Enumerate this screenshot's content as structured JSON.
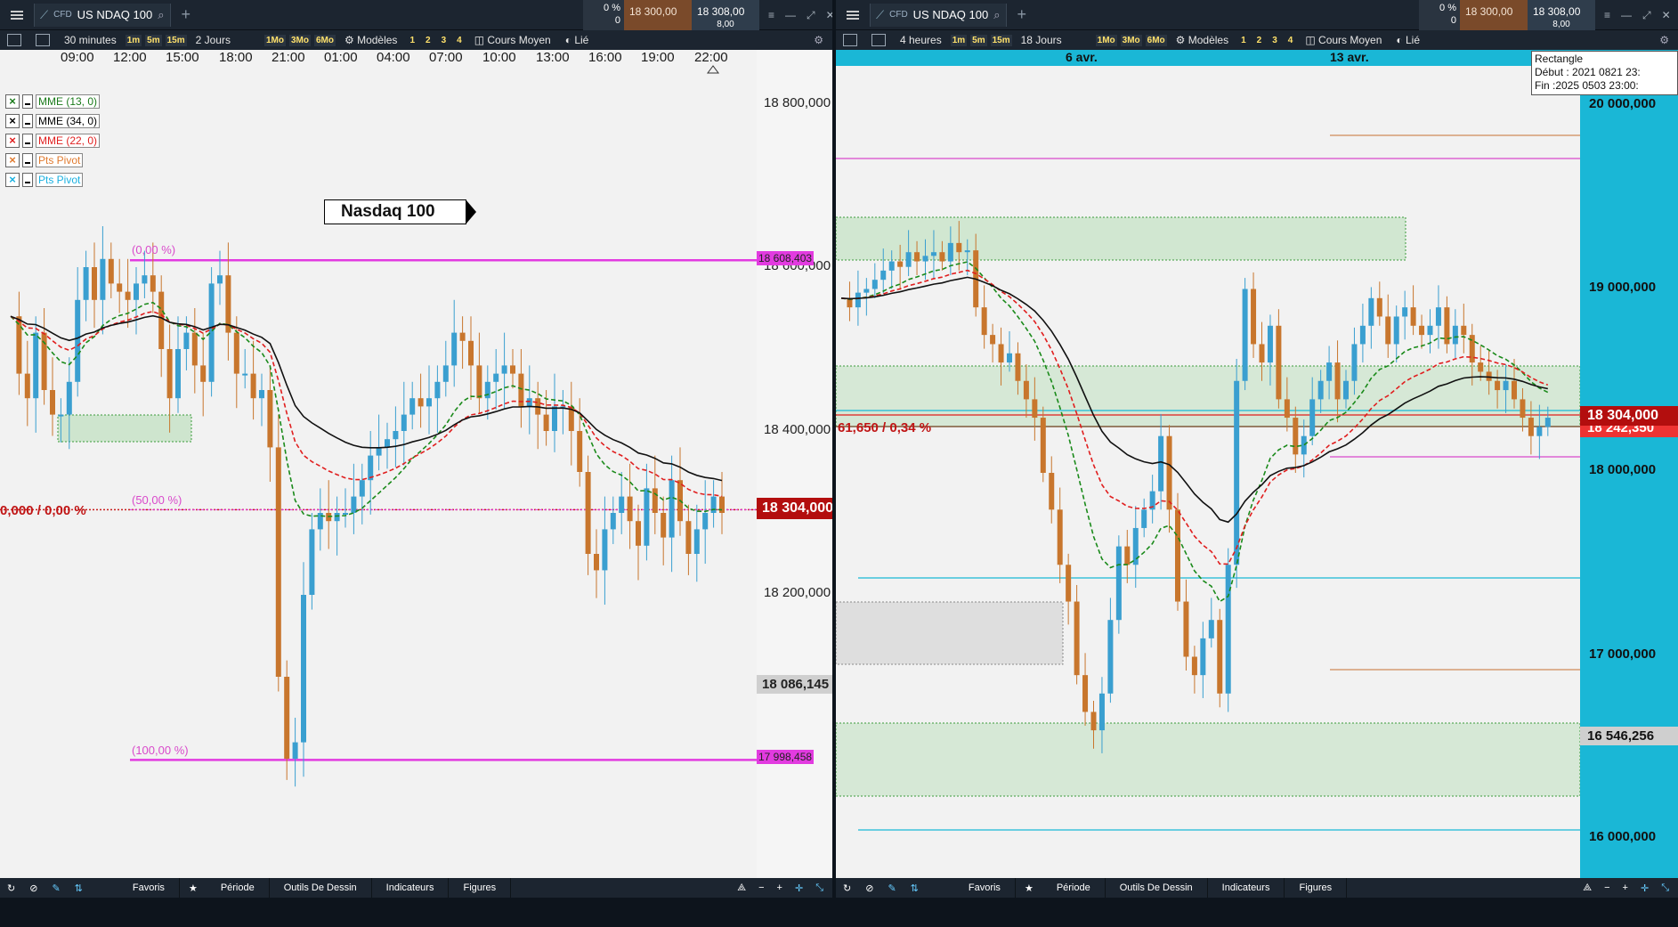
{
  "left": {
    "instrument": {
      "badge": "CFD",
      "name": "US NDAQ 100"
    },
    "quote": {
      "pct": "0 %",
      "pct_sub": "0",
      "bid": "18 300,00",
      "ask": "18 308,00",
      "spread": "8,00"
    },
    "toolbar": {
      "period": "30 minutes",
      "tf": [
        "1m",
        "5m",
        "15m"
      ],
      "range": "2 Jours",
      "tf2": [
        "1Mo",
        "3Mo",
        "6Mo"
      ],
      "models": "Modèles",
      "nums": [
        "1",
        "2",
        "3",
        "4"
      ],
      "price_type": "Cours Moyen",
      "linked": "Lié"
    },
    "time_axis": [
      "09:00",
      "12:00",
      "15:00",
      "18:00",
      "21:00",
      "01:00",
      "04:00",
      "07:00",
      "10:00",
      "13:00",
      "16:00",
      "19:00",
      "22:00"
    ],
    "indicators": [
      {
        "mark": "×",
        "label": "MME (13, 0)",
        "color": "#1a7a1a"
      },
      {
        "mark": "×",
        "label": "MME (34, 0)",
        "color": "#000000"
      },
      {
        "mark": "×",
        "label": "MME (22, 0)",
        "color": "#e01e1e"
      },
      {
        "mark": "×",
        "label": "Pts Pivot",
        "color": "#e07a2e"
      },
      {
        "mark": "×",
        "label": "Pts Pivot",
        "color": "#1ab0e0"
      }
    ],
    "chart_label": "Nasdaq 100",
    "fib": {
      "f0": "(0,00 %)",
      "f50": "(50,00 %)",
      "f100": "(100,00 %)"
    },
    "y_axis": [
      "18 800,000",
      "18 600,000",
      "18 400,000",
      "18 200,000"
    ],
    "tags": {
      "top": "18 608,403",
      "price": "18 304,000",
      "low_label": "18 086,145",
      "bottom": "17 998,458"
    },
    "left_text": "0,000 / 0,00 %",
    "bottom": [
      "Favoris",
      "Période",
      "Outils De Dessin",
      "Indicateurs",
      "Figures"
    ]
  },
  "right": {
    "instrument": {
      "badge": "CFD",
      "name": "US NDAQ 100"
    },
    "quote": {
      "pct": "0 %",
      "pct_sub": "0",
      "bid": "18 300,00",
      "ask": "18 308,00",
      "spread": "8,00"
    },
    "toolbar": {
      "period": "4 heures",
      "tf": [
        "1m",
        "5m",
        "15m"
      ],
      "range": "18 Jours",
      "tf2": [
        "1Mo",
        "3Mo",
        "6Mo"
      ],
      "models": "Modèles",
      "nums": [
        "1",
        "2",
        "3",
        "4"
      ],
      "price_type": "Cours Moyen",
      "linked": "Lié"
    },
    "dates": [
      "6 avr.",
      "13 avr."
    ],
    "tooltip": {
      "title": "Rectangle",
      "start": "Début : 2021 0821 23:",
      "end": "Fin :2025 0503 23:00:"
    },
    "y_axis": [
      "20 000,000",
      "19 000,000",
      "18 000,000",
      "17 000,000",
      "16 000,000"
    ],
    "tags": {
      "price": "18 304,000",
      "price_under": "18 242,350",
      "low": "16 546,256"
    },
    "change_text": "61,650 / 0,34 %",
    "bottom": [
      "Favoris",
      "Période",
      "Outils De Dessin",
      "Indicateurs",
      "Figures"
    ]
  },
  "colors": {
    "accent": "#d94acb",
    "cyan": "#19b9d6",
    "bull": "#3a9fd0",
    "bear": "#c8762d",
    "price_tag": "#b30e0e"
  },
  "chart_data": [
    {
      "type": "candlestick",
      "title": "Nasdaq 100",
      "timeframe": "30 minutes",
      "ylim": [
        17950,
        18900
      ],
      "levels": {
        "fib_0": 18608.403,
        "fib_50": 18304.0,
        "fib_100": 17998.458,
        "last": 18304.0,
        "marker": 18086.145
      }
    },
    {
      "type": "candlestick",
      "timeframe": "4 heures",
      "ylim": [
        15850,
        20300
      ],
      "levels": {
        "last": 18304.0,
        "low": 16546.256
      }
    }
  ]
}
